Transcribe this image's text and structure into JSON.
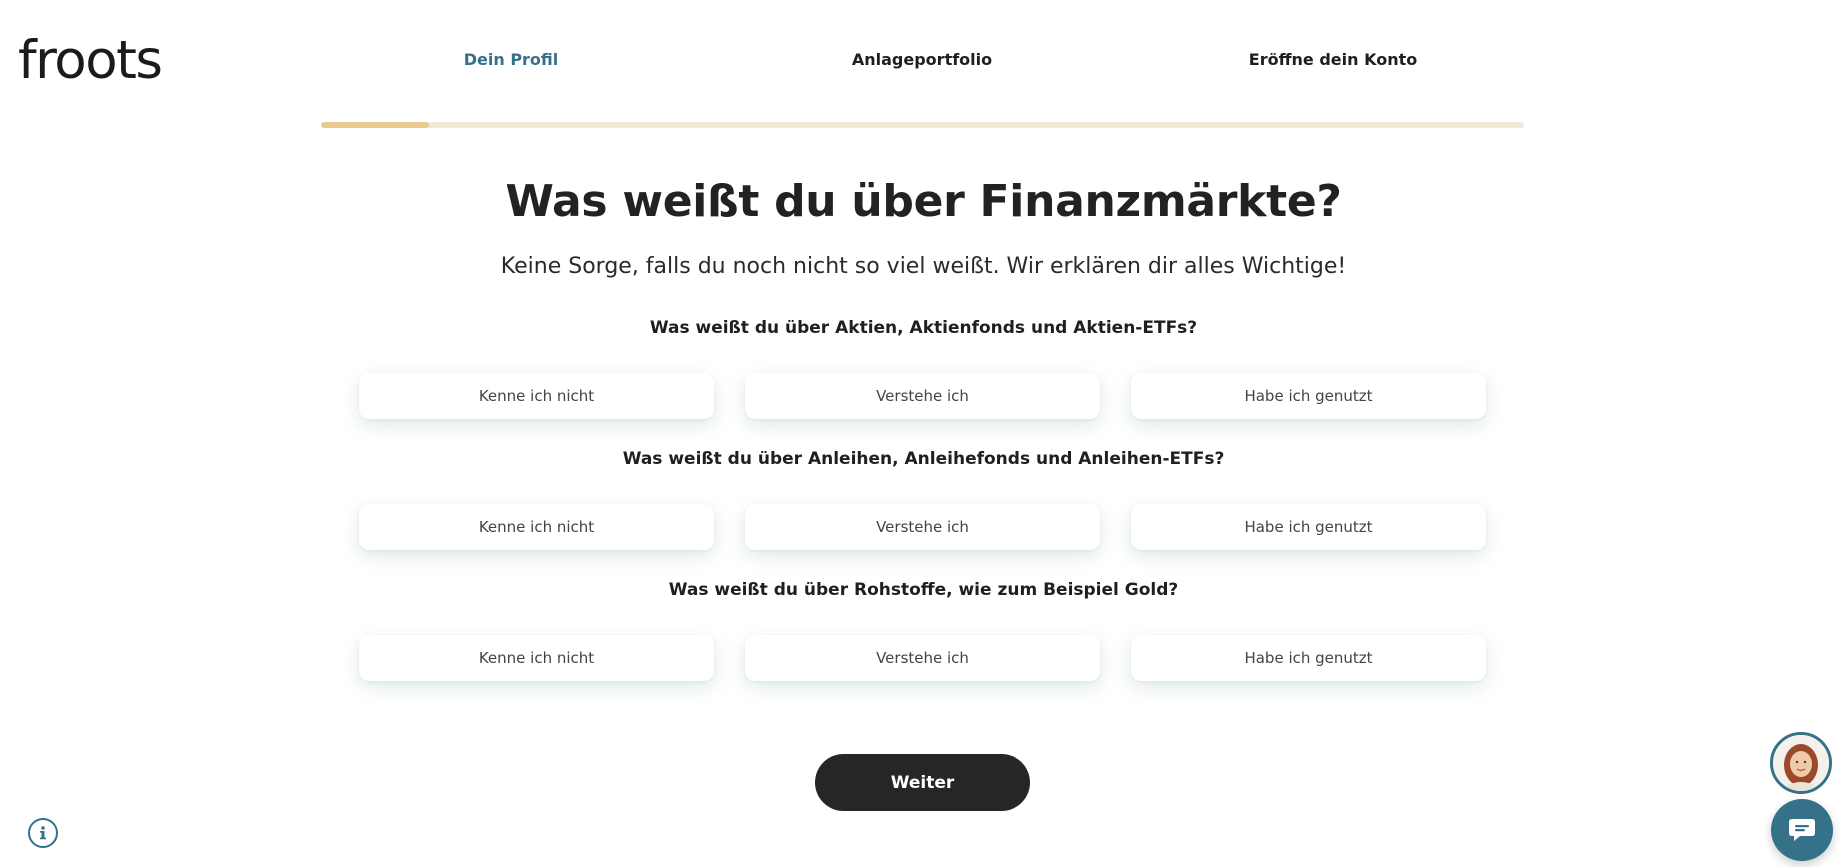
{
  "brand": {
    "logo_text": "froots",
    "accent_color": "#36718a"
  },
  "steps": [
    {
      "label": "Dein Profil",
      "active": true
    },
    {
      "label": "Anlageportfolio",
      "active": false
    },
    {
      "label": "Eröffne dein Konto",
      "active": false
    }
  ],
  "progress": {
    "fraction": 0.09
  },
  "header": {
    "title": "Was weißt du über Finanzmärkte?",
    "subtitle": "Keine Sorge, falls du noch nicht so viel weißt. Wir erklären dir alles Wichtige!"
  },
  "questions": [
    {
      "text": "Was weißt du über Aktien, Aktienfonds und Aktien-ETFs?",
      "options": [
        "Kenne ich nicht",
        "Verstehe ich",
        "Habe ich genutzt"
      ]
    },
    {
      "text": "Was weißt du über Anleihen, Anleihefonds und Anleihen-ETFs?",
      "options": [
        "Kenne ich nicht",
        "Verstehe ich",
        "Habe ich genutzt"
      ]
    },
    {
      "text": "Was weißt du über Rohstoffe, wie zum Beispiel Gold?",
      "options": [
        "Kenne ich nicht",
        "Verstehe ich",
        "Habe ich genutzt"
      ]
    }
  ],
  "actions": {
    "continue_label": "Weiter"
  },
  "icons": {
    "info": "info-icon",
    "advisor": "advisor-avatar",
    "chat": "chat-bubble-icon"
  }
}
